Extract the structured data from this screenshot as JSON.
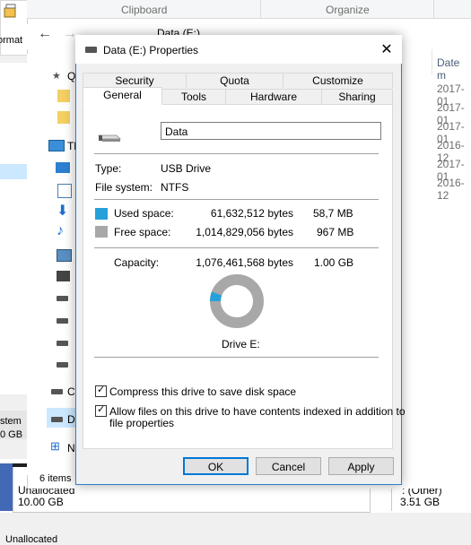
{
  "background": {
    "ribbon_format_label": "ormat",
    "left_system_label": "stem",
    "left_gb_label": "0 GB",
    "disk_row": {
      "partition1_label": "Unallocated",
      "partition1_size": "10.00 GB",
      "partition2_label": ": (Other)",
      "partition2_size": "3.51 GB"
    },
    "legend_label": "Unallocated"
  },
  "explorer": {
    "ribbon_groups": [
      "Clipboard",
      "Organize"
    ],
    "address": "Data (E:)",
    "nav_labels": {
      "q": "Q",
      "t": "Tl",
      "c": "C",
      "d": "D",
      "n": "N"
    },
    "column_header": "Date m",
    "dates": [
      "2017-01",
      "2017-01",
      "2017-01",
      "2016-12",
      "2017-01",
      "2016-12"
    ],
    "status_items": "6 items"
  },
  "dialog": {
    "title": "Data (E:) Properties",
    "tabs_row1": [
      "Security",
      "Quota",
      "Customize"
    ],
    "tabs_row2": [
      "General",
      "Tools",
      "Hardware",
      "Sharing"
    ],
    "active_tab": "General",
    "volume_name": "Data",
    "type_label": "Type:",
    "type_value": "USB Drive",
    "fs_label": "File system:",
    "fs_value": "NTFS",
    "used_label": "Used space:",
    "used_bytes": "61,632,512 bytes",
    "used_human": "58,7 MB",
    "free_label": "Free space:",
    "free_bytes": "1,014,829,056 bytes",
    "free_human": "967 MB",
    "capacity_label": "Capacity:",
    "capacity_bytes": "1,076,461,568 bytes",
    "capacity_human": "1.00 GB",
    "used_fraction": 0.0573,
    "drive_caption": "Drive E:",
    "compress_label": "Compress this drive to save disk space",
    "compress_checked": true,
    "index_label_line1": "Allow files on this drive to have contents indexed in addition to",
    "index_label_line2": "file properties",
    "index_checked": true,
    "ok_label": "OK",
    "cancel_label": "Cancel",
    "apply_label": "Apply",
    "colors": {
      "used": "#26a0da",
      "free": "#a8a8a8",
      "accent": "#0078d7"
    }
  }
}
